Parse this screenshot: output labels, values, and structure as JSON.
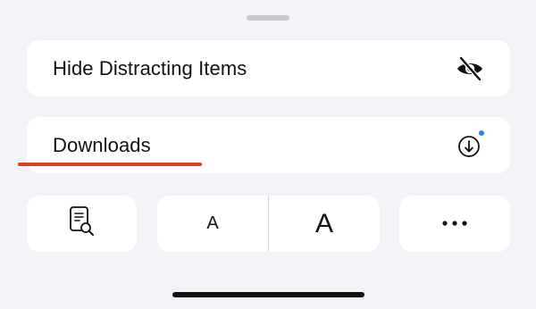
{
  "sheet": {
    "rows": {
      "hide_distracting": {
        "label": "Hide Distracting Items",
        "icon": "eye-slash-icon"
      },
      "downloads": {
        "label": "Downloads",
        "icon": "download-circle-icon",
        "badge_color": "#2f7cf6"
      }
    },
    "buttons": {
      "reader": {
        "icon": "reader-search-icon"
      },
      "font_smaller": {
        "label": "A"
      },
      "font_larger": {
        "label": "A"
      },
      "more": {
        "icon": "ellipsis-icon"
      }
    },
    "highlight_color": "#d8401f"
  }
}
